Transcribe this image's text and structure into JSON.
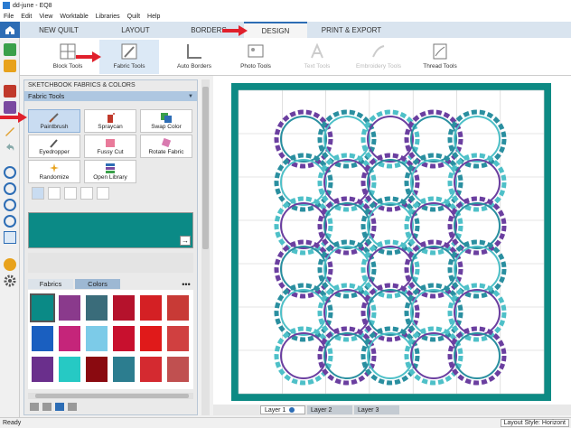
{
  "window": {
    "title": "dd-june - EQ8"
  },
  "menubar": {
    "items": [
      "File",
      "Edit",
      "View",
      "Worktable",
      "Libraries",
      "Quilt",
      "Help"
    ]
  },
  "tabs": [
    {
      "label": "NEW QUILT"
    },
    {
      "label": "LAYOUT"
    },
    {
      "label": "BORDERS"
    },
    {
      "label": "DESIGN",
      "active": true
    },
    {
      "label": "PRINT & EXPORT"
    }
  ],
  "ribbon": {
    "block_tools": "Block Tools",
    "fabric_tools": "Fabric Tools",
    "auto_borders": "Auto Borders",
    "photo_tools": "Photo Tools",
    "text_tools": "Text Tools",
    "embroidery_tools": "Embroidery Tools",
    "thread_tools": "Thread Tools"
  },
  "panel": {
    "heading": "SKETCHBOOK FABRICS & COLORS",
    "subheading": "Fabric Tools",
    "tools": {
      "paintbrush": "Paintbrush",
      "spraycan": "Spraycan",
      "swap_color": "Swap Color",
      "eyedropper": "Eyedropper",
      "fussy_cut": "Fussy Cut",
      "rotate_fabric": "Rotate Fabric",
      "randomize": "Randomize",
      "open_library": "Open Library"
    },
    "selected_color": "#0b8a86",
    "tab_fabrics": "Fabrics",
    "tab_colors": "Colors",
    "more": "•••",
    "swatches": [
      "#0a8a86",
      "#8a3a8c",
      "#3a6c7a",
      "#b5122c",
      "#d42024",
      "#c83a36",
      "#1a5fc0",
      "#c5257a",
      "#7ccbe8",
      "#c8102e",
      "#e01a1a",
      "#d04040",
      "#6a2f8c",
      "#26c9c4",
      "#8a0a10",
      "#2c7d8f",
      "#d42a30",
      "#c05050"
    ]
  },
  "layers": {
    "layer1": "Layer 1",
    "layer2": "Layer 2",
    "layer3": "Layer 3"
  },
  "status": {
    "left": "Ready",
    "right": "Layout Style: Horizont"
  },
  "quilt": {
    "border_color": "#0d8a84",
    "ring_colors": [
      "#6b3fa0",
      "#2a8fa0",
      "#4ec0c8"
    ]
  }
}
